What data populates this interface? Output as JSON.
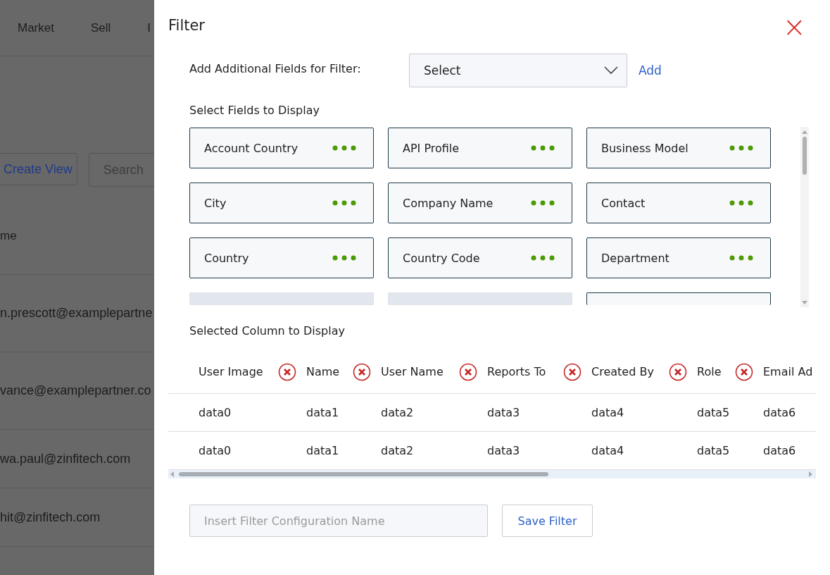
{
  "background": {
    "nav": [
      "Market",
      "Sell",
      "I"
    ],
    "create_view": "Create View",
    "search": {
      "placeholder": "Search"
    },
    "column_header": "me",
    "rows": [
      "n.prescott@examplepartne",
      "vance@examplepartner.co",
      "wa.paul@zinfitech.com",
      "hit@zinfitech.com"
    ]
  },
  "panel": {
    "title": "Filter",
    "close": "×",
    "additional_fields": {
      "label": "Add Additional Fields for Filter:",
      "select": "Select",
      "add": "Add"
    },
    "fields_heading": "Select Fields to Display",
    "fields": [
      {
        "label": "Account Country"
      },
      {
        "label": "API Profile"
      },
      {
        "label": "Business Model"
      },
      {
        "label": "City"
      },
      {
        "label": "Company Name"
      },
      {
        "label": "Contact"
      },
      {
        "label": "Country"
      },
      {
        "label": "Country Code"
      },
      {
        "label": "Department"
      }
    ],
    "cut_off_cards": [
      {
        "shaded": true
      },
      {
        "shaded": true
      },
      {
        "shaded": false
      }
    ],
    "columns_heading": "Selected Column to Display",
    "table": {
      "columns": [
        "User Image",
        "Name",
        "User Name",
        "Reports To",
        "Created By",
        "Role",
        "Email Ad"
      ],
      "rows": [
        [
          "data0",
          "data1",
          "data2",
          "data3",
          "data4",
          "data5",
          "data6"
        ],
        [
          "data0",
          "data1",
          "data2",
          "data3",
          "data4",
          "data5",
          "data6"
        ]
      ]
    },
    "config_name": {
      "placeholder": "Insert Filter Configuration Name"
    },
    "save": "Save Filter"
  }
}
